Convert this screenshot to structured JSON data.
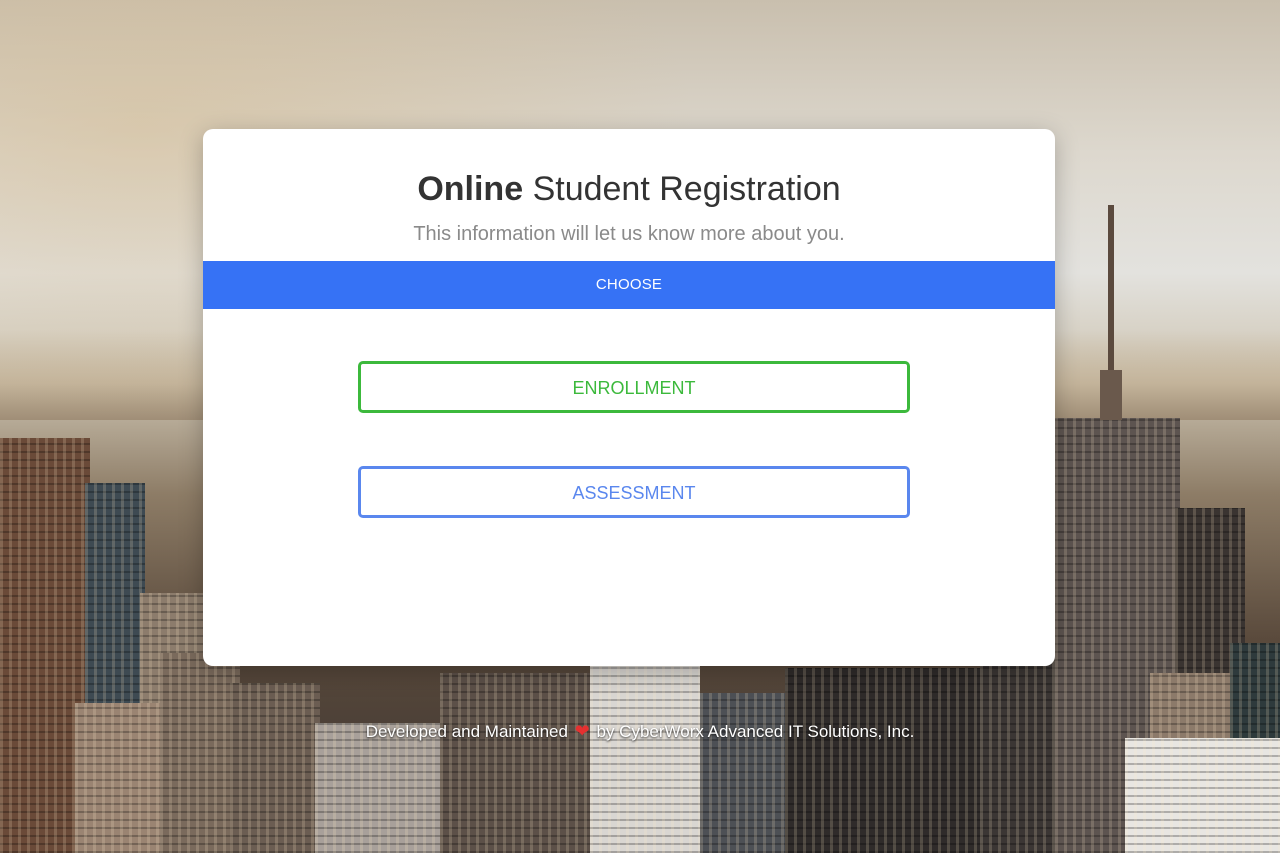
{
  "card": {
    "title_strong": "Online",
    "title_rest": " Student Registration",
    "subtitle": "This information will let us know more about you."
  },
  "tabs": [
    {
      "label": "CHOOSE"
    }
  ],
  "buttons": {
    "enrollment": "ENROLLMENT",
    "assessment": "ASSESSMENT"
  },
  "footer": {
    "before": "Developed and Maintained ",
    "icon": "heart-icon",
    "after": " by CyberWorx Advanced IT Solutions, Inc."
  },
  "colors": {
    "tab_bar": "#3672f5",
    "enrollment": "#3cb93c",
    "assessment": "#5a87ee",
    "heart": "#e53030"
  }
}
